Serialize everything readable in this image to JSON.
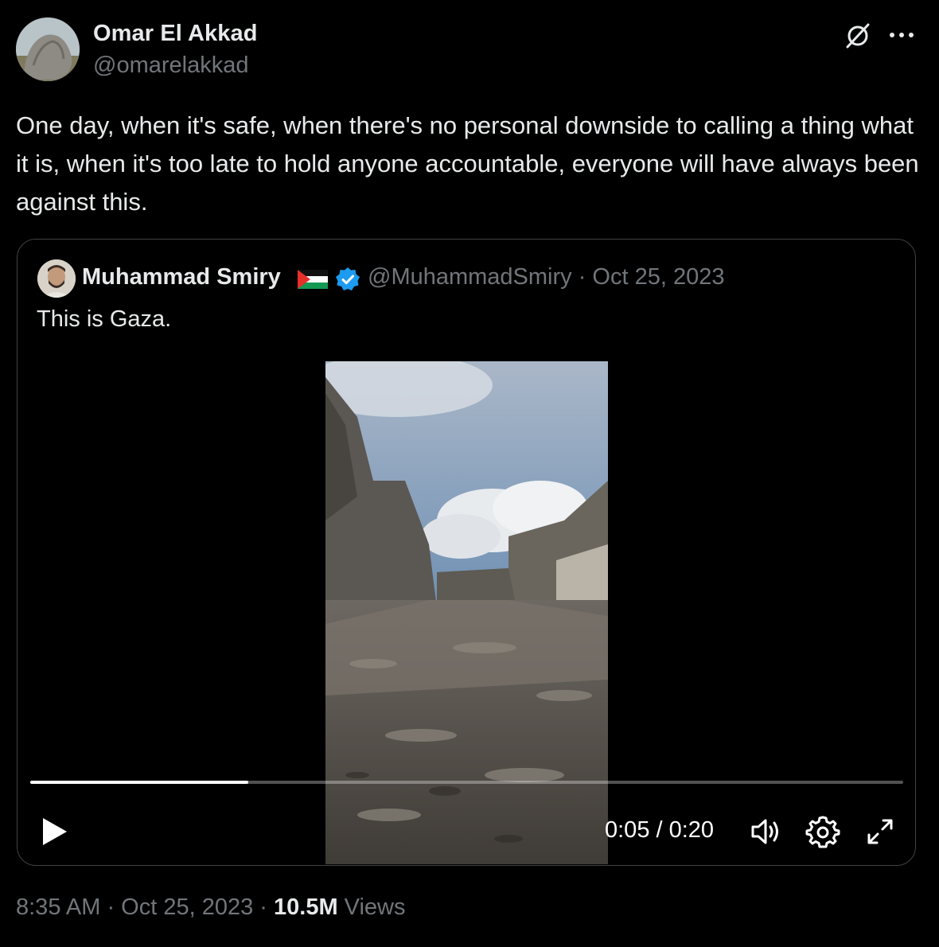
{
  "author": {
    "name": "Omar El Akkad",
    "handle": "@omarelakkad"
  },
  "tweet": {
    "text": "One day, when it's safe, when there's no personal downside to calling a thing what it is, when it's too late to hold anyone accountable, everyone will have always been against this."
  },
  "quoted_tweet": {
    "name": "Muhammad Smiry",
    "handle_date": "@MuhammadSmiry · Oct 25, 2023",
    "text": "This is Gaza.",
    "video": {
      "current_time": "0:05",
      "duration": "0:20",
      "timecode": "0:05 / 0:20",
      "progress_fraction": 0.25
    }
  },
  "meta": {
    "time_date": "8:35 AM · Oct 25, 2023 · ",
    "views_count": "10.5M",
    "views_label": " Views"
  },
  "colors": {
    "background": "#000000",
    "text_primary": "#e7e9ea",
    "text_secondary": "#71767b",
    "border": "#3e4144",
    "verified_blue": "#1d9bf0"
  },
  "icons": [
    "grok-icon",
    "more-icon",
    "verified-badge-icon",
    "palestine-flag-icon",
    "play-icon",
    "volume-icon",
    "settings-icon",
    "fullscreen-icon"
  ]
}
